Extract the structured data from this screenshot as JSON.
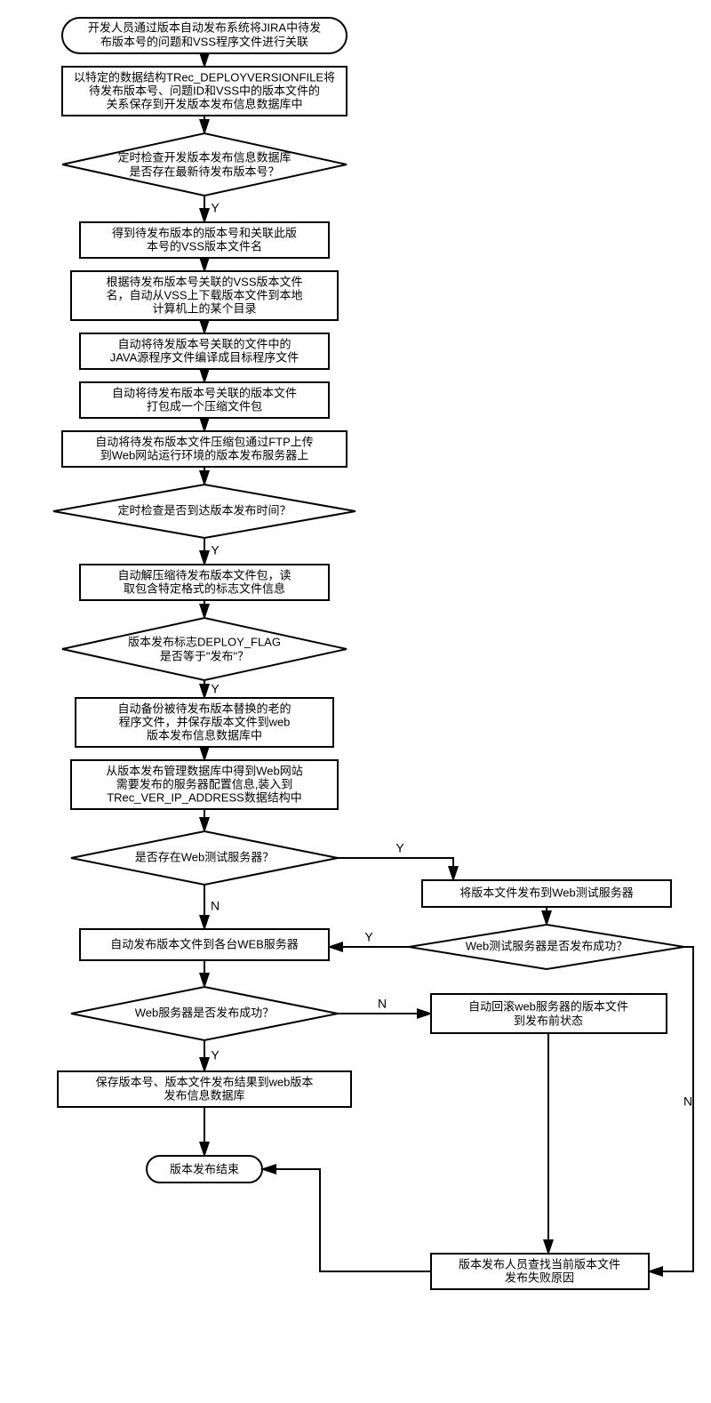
{
  "flowchart": {
    "n1": {
      "type": "terminator",
      "lines": [
        "开发人员通过版本自动发布系统将JIRA中待发",
        "布版本号的问题和VSS程序文件进行关联"
      ]
    },
    "n2": {
      "type": "process",
      "lines": [
        "以特定的数据结构TRec_DEPLOYVERSIONFILE将",
        "待发布版本号、问题ID和VSS中的版本文件的",
        "关系保存到开发版本发布信息数据库中"
      ]
    },
    "n3": {
      "type": "decision",
      "lines": [
        "定时检查开发版本发布信息数据库",
        "是否存在最新待发布版本号？"
      ]
    },
    "n4": {
      "type": "process",
      "lines": [
        "得到待发布版本的版本号和关联此版",
        "本号的VSS版本文件名"
      ]
    },
    "n5": {
      "type": "process",
      "lines": [
        "根据待发布版本号关联的VSS版本文件",
        "名，自动从VSS上下载版本文件到本地",
        "计算机上的某个目录"
      ]
    },
    "n6": {
      "type": "process",
      "lines": [
        "自动将待发版本号关联的文件中的",
        "JAVA源程序文件编译成目标程序文件"
      ]
    },
    "n7": {
      "type": "process",
      "lines": [
        "自动将待发布版本号关联的版本文件",
        "打包成一个压缩文件包"
      ]
    },
    "n8": {
      "type": "process",
      "lines": [
        "自动将待发布版本文件压缩包通过FTP上传",
        "到Web网站运行环境的版本发布服务器上"
      ]
    },
    "n9": {
      "type": "decision",
      "lines": [
        "定时检查是否到达版本发布时间？"
      ]
    },
    "n10": {
      "type": "process",
      "lines": [
        "自动解压缩待发布版本文件包，读",
        "取包含特定格式的标志文件信息"
      ]
    },
    "n11": {
      "type": "decision",
      "lines": [
        "版本发布标志DEPLOY_FLAG",
        "是否等于\"发布\"？"
      ]
    },
    "n12": {
      "type": "process",
      "lines": [
        "自动备份被待发布版本替换的老的",
        "程序文件，并保存版本文件到web",
        "版本发布信息数据库中"
      ]
    },
    "n13": {
      "type": "process",
      "lines": [
        "从版本发布管理数据库中得到Web网站",
        "需要发布的服务器配置信息,装入到",
        "TRec_VER_IP_ADDRESS数据结构中"
      ]
    },
    "n14": {
      "type": "decision",
      "lines": [
        "是否存在Web测试服务器？"
      ]
    },
    "n15": {
      "type": "process",
      "lines": [
        "将版本文件发布到Web测试服务器"
      ]
    },
    "n16": {
      "type": "decision",
      "lines": [
        "Web测试服务器是否发布成功？"
      ]
    },
    "n17": {
      "type": "process",
      "lines": [
        "自动发布版本文件到各台WEB服务器"
      ]
    },
    "n18": {
      "type": "decision",
      "lines": [
        "Web服务器是否发布成功？"
      ]
    },
    "n19": {
      "type": "process",
      "lines": [
        "自动回滚web服务器的版本文件",
        "到发布前状态"
      ]
    },
    "n20": {
      "type": "process",
      "lines": [
        "保存版本号、版本文件发布结果到web版本",
        "发布信息数据库"
      ]
    },
    "n21": {
      "type": "terminator",
      "lines": [
        "版本发布结束"
      ]
    },
    "n22": {
      "type": "process",
      "lines": [
        "版本发布人员查找当前版本文件",
        "发布失败原因"
      ]
    },
    "labels": {
      "yes": "Y",
      "no": "N"
    }
  }
}
